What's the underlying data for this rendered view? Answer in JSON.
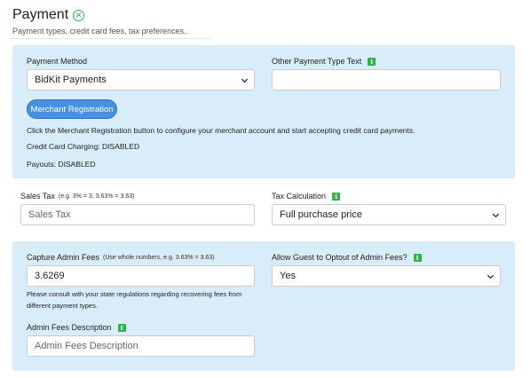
{
  "header": {
    "title": "Payment",
    "subtitle": "Payment types, credit card fees, tax preferences."
  },
  "payment": {
    "method_label": "Payment Method",
    "method_value": "BidKit Payments",
    "other_label": "Other Payment Type Text",
    "other_value": "",
    "merchant_button": "Merchant Registration",
    "instruction": "Click the Merchant Registration button to configure your merchant account and start accepting credit card payments.",
    "cc_status": "Credit Card Charging: DISABLED",
    "payouts_status": "Payouts: DISABLED"
  },
  "tax": {
    "sales_label": "Sales Tax",
    "sales_hint": "(e.g. 3% = 3, 3.63% = 3.63)",
    "sales_placeholder": "Sales Tax",
    "calc_label": "Tax Calculation",
    "calc_value": "Full purchase price"
  },
  "fees": {
    "capture_label": "Capture Admin Fees",
    "capture_hint": "(Use whole numbers, e.g. 3.63% = 3.63)",
    "capture_value": "3.6269",
    "note": "Please consult with your state regulations regarding recovering fees from different payment types.",
    "optout_label": "Allow Guest to Optout of Admin Fees?",
    "optout_value": "Yes",
    "desc_label": "Admin Fees Description",
    "desc_placeholder": "Admin Fees Description"
  },
  "colors": {
    "panel_bg": "#d8ecf9",
    "accent_button": "#4a90e2",
    "info_icon": "#34b24a"
  },
  "icons": {
    "title_icon": "close-circle-icon",
    "info": "info-icon",
    "select_arrow": "chevron-down-icon"
  }
}
